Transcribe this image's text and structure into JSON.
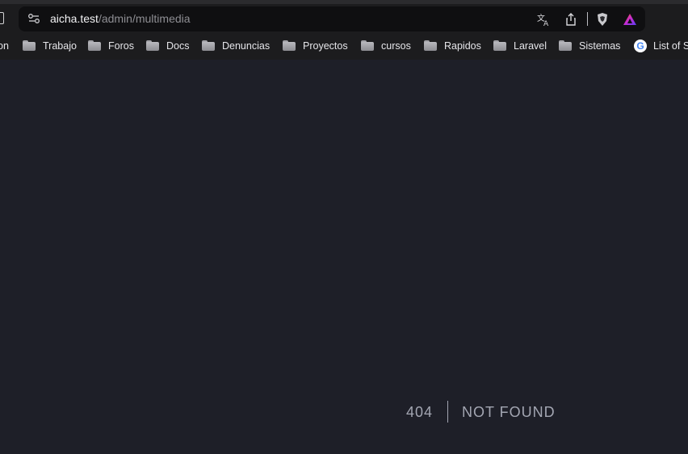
{
  "browser": {
    "url_host": "aicha.test",
    "url_path": "/admin/multimedia",
    "bookmarks": [
      {
        "label": "on",
        "icon": "none"
      },
      {
        "label": "Trabajo",
        "icon": "folder-icon"
      },
      {
        "label": "Foros",
        "icon": "folder-icon"
      },
      {
        "label": "Docs",
        "icon": "folder-icon"
      },
      {
        "label": "Denuncias",
        "icon": "folder-icon"
      },
      {
        "label": "Proyectos",
        "icon": "folder-icon"
      },
      {
        "label": "cursos",
        "icon": "folder-icon"
      },
      {
        "label": "Rapidos",
        "icon": "folder-icon"
      },
      {
        "label": "Laravel",
        "icon": "folder-icon"
      },
      {
        "label": "Sistemas",
        "icon": "folder-icon"
      },
      {
        "label": "List of S",
        "icon": "google-icon"
      }
    ],
    "icons": {
      "site_settings": "site-settings-icon",
      "translate": "translate-icon",
      "share": "share-icon",
      "brave_shields": "brave-shields-icon",
      "rewards": "brave-rewards-icon"
    }
  },
  "page": {
    "status_code": "404",
    "status_message": "NOT FOUND"
  },
  "colors": {
    "background": "#1e1f28",
    "text": "#a3a6b2",
    "toolbar": "#1c1c1e"
  }
}
